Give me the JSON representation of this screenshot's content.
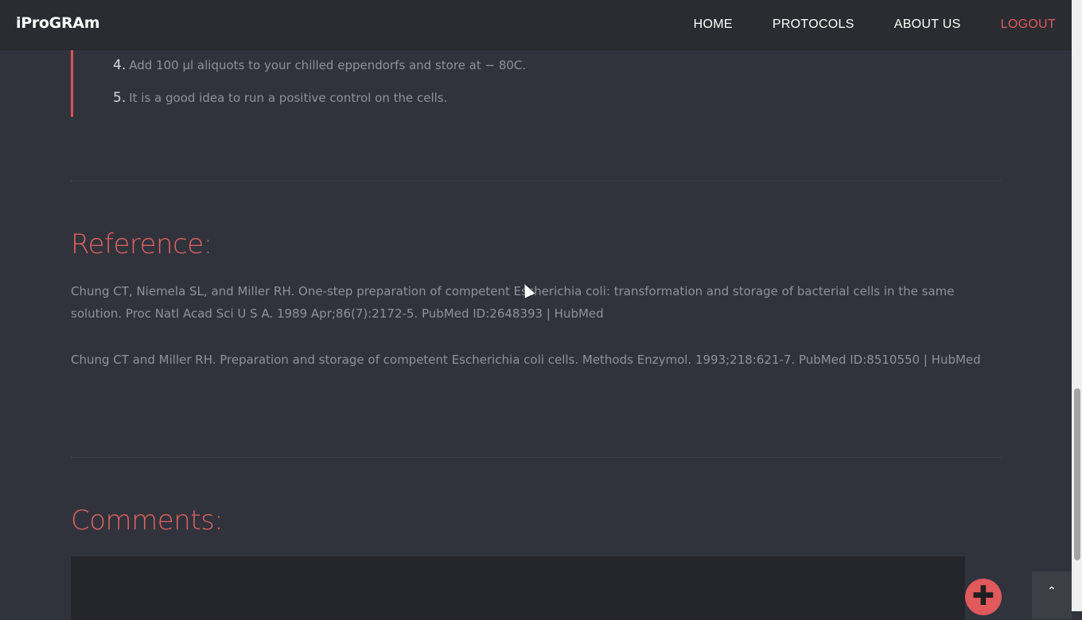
{
  "header": {
    "brand": "iProGRAm",
    "nav": [
      "HOME",
      "PROTOCOLS",
      "ABOUT US",
      "LOGOUT"
    ]
  },
  "steps": [
    {
      "number": "4.",
      "text": "Add 100 µl aliquots to your chilled eppendorfs and store at − 80C."
    },
    {
      "number": "5.",
      "text": "It is a good idea to run a positive control on the cells."
    }
  ],
  "reference": {
    "title": "Reference:",
    "entries": [
      "Chung CT, Niemela SL, and Miller RH. One-step preparation of competent Escherichia coli: transformation and storage of bacterial cells in the same solution. Proc Natl Acad Sci U S A. 1989 Apr;86(7):2172-5. PubMed ID:2648393 | HubMed",
      "Chung CT and Miller RH. Preparation and storage of competent Escherichia coli cells. Methods Enzymol. 1993;218:621-7. PubMed ID:8510550 | HubMed"
    ]
  },
  "comments": {
    "title": "Comments:"
  },
  "buttons": {
    "add_icon": "plus-icon",
    "scroll_top_icon": "chevron-up-icon",
    "add_glyph": "✚",
    "scroll_top_glyph": "⌃"
  },
  "colors": {
    "accent": "#e05a5c",
    "background": "#30333c",
    "navbar": "#2a2c31"
  }
}
